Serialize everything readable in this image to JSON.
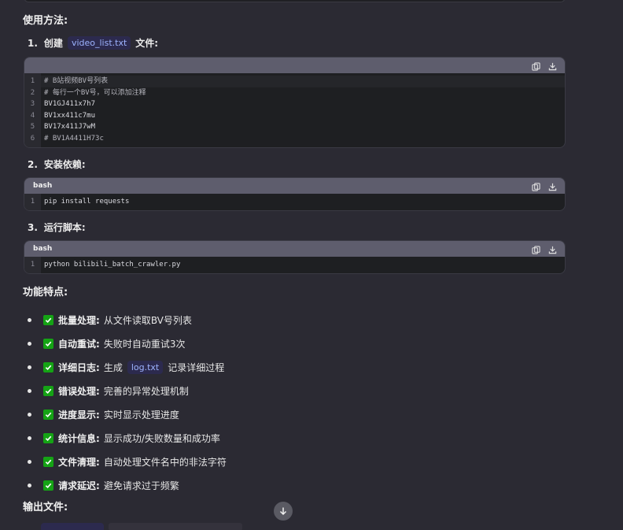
{
  "usage": {
    "heading": "使用方法:",
    "steps": [
      {
        "num": "1.",
        "before": "创建",
        "code": "video_list.txt",
        "after": "文件:",
        "block": {
          "lang": "",
          "lines": [
            "# B站视频BV号列表",
            "# 每行一个BV号，可以添加注释",
            "BV1GJ411x7h7",
            "BV1xx411c7mu",
            "BV17x411J7wM",
            "# BV1A4411H73c"
          ]
        }
      },
      {
        "num": "2.",
        "before": "安装依赖:",
        "block": {
          "lang": "bash",
          "lines": [
            "pip install requests"
          ]
        }
      },
      {
        "num": "3.",
        "before": "运行脚本:",
        "block": {
          "lang": "bash",
          "lines": [
            "python bilibili_batch_crawler.py"
          ]
        }
      }
    ]
  },
  "features": {
    "heading": "功能特点:",
    "items": [
      {
        "label": "批量处理:",
        "desc": "从文件读取BV号列表"
      },
      {
        "label": "自动重试:",
        "desc": "失败时自动重试3次"
      },
      {
        "label": "详细日志:",
        "desc_before": "生成",
        "code": "log.txt",
        "desc_after": "记录详细过程"
      },
      {
        "label": "错误处理:",
        "desc": "完善的异常处理机制"
      },
      {
        "label": "进度显示:",
        "desc": "实时显示处理进度"
      },
      {
        "label": "统计信息:",
        "desc": "显示成功/失败数量和成功率"
      },
      {
        "label": "文件清理:",
        "desc": "自动处理文件名中的非法字符"
      },
      {
        "label": "请求延迟:",
        "desc": "避免请求过于频繁"
      }
    ]
  },
  "output": {
    "heading": "输出文件:"
  },
  "icons": {
    "copy": "copy-icon",
    "download": "download-icon",
    "check": "check-icon",
    "scroll_down": "arrow-down-icon"
  },
  "colors": {
    "background": "#2b2a33",
    "code_header": "#5e5d6d",
    "inline_code_bg": "#2c2a4e",
    "inline_code_fg": "#9db3ff",
    "check_green": "#15a315"
  }
}
